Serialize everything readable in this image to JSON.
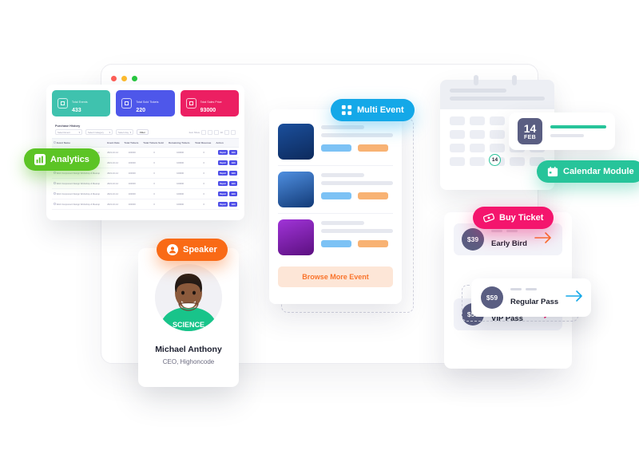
{
  "browser": {
    "name": "browser-window",
    "dots": [
      "#ff5f57",
      "#febc2e",
      "#28c840"
    ]
  },
  "dashboard": {
    "stats": [
      {
        "label": "Total Events",
        "value": "433",
        "color": "#3fc2ae",
        "icon": "list-icon"
      },
      {
        "label": "Total Sold Tickets",
        "value": "220",
        "color": "#4e57ea",
        "icon": "grid-icon"
      },
      {
        "label": "Total Sales Price",
        "value": "93000",
        "color": "#ec1f62",
        "icon": "chart-icon"
      }
    ],
    "panel_title": "Purchase History",
    "filters": {
      "select_event": "Select Event",
      "select_category": "Select Category",
      "select_day": "Select day",
      "filter_button": "Filter",
      "pager_label": "Item Show",
      "pager_value": "10"
    },
    "table": {
      "columns": [
        "Event Name",
        "Event Date",
        "Total Tickets",
        "Total Tickets Sold",
        "Remaining Tickets",
        "Total Revenue",
        "Action"
      ],
      "rows": [
        {
          "name": "Web Component Design Workshop & Meetup",
          "date": "2021-10-12",
          "total": "100000",
          "sold": "0",
          "remaining": "100000",
          "revenue": "0"
        },
        {
          "name": "Web Component Design Workshop & Meetup",
          "date": "2021-10-12",
          "total": "100000",
          "sold": "0",
          "remaining": "100000",
          "revenue": "0"
        },
        {
          "name": "Web Component Design Workshop & Meetup",
          "date": "2021-10-12",
          "total": "100000",
          "sold": "0",
          "remaining": "100000",
          "revenue": "0"
        },
        {
          "name": "Web Component Design Workshop & Meetup",
          "date": "2021-10-12",
          "total": "100000",
          "sold": "0",
          "remaining": "100000",
          "revenue": "0"
        },
        {
          "name": "Web Component Design Workshop & Meetup",
          "date": "2021-10-12",
          "total": "100000",
          "sold": "0",
          "remaining": "100000",
          "revenue": "0"
        },
        {
          "name": "Web Component Design Workshop & Meetup",
          "date": "2021-10-12",
          "total": "100000",
          "sold": "0",
          "remaining": "100000",
          "revenue": "0"
        }
      ],
      "action_report": "Report",
      "action_edit": "Edit"
    }
  },
  "badges": {
    "analytics": {
      "label": "Analytics",
      "color": "#5cc425",
      "icon": "analytics-chart-icon"
    },
    "multi_event": {
      "label": "Multi Event",
      "color": "#14a8e8",
      "icon": "grid-dots-icon"
    },
    "speaker": {
      "label": "Speaker",
      "color": "#f96a16",
      "icon": "user-circle-icon"
    },
    "calendar_module": {
      "label": "Calendar Module",
      "color": "#27c49a",
      "icon": "calendar-icon"
    },
    "buy_ticket": {
      "label": "Buy Ticket",
      "color": "#f4156d",
      "icon": "ticket-icon"
    }
  },
  "speaker": {
    "name": "Michael Anthony",
    "role": "CEO, Highoncode",
    "avatar_alt": "speaker-portrait"
  },
  "multi_event": {
    "events": [
      {
        "thumb_alt": "concert-crowd-blue",
        "thumb_from": "#1b4f9c",
        "thumb_to": "#0d2a5c"
      },
      {
        "thumb_alt": "stage-lights-blue",
        "thumb_from": "#4f8fe0",
        "thumb_to": "#123a77"
      },
      {
        "thumb_alt": "concert-purple",
        "thumb_from": "#a034d8",
        "thumb_to": "#5c1080"
      }
    ],
    "browse_button": "Browse More Event"
  },
  "calendar": {
    "today": "14",
    "event": {
      "day": "14",
      "month": "FEB"
    }
  },
  "tickets": [
    {
      "price": "$39",
      "name": "Early Bird",
      "arrow_color": "#f9742c"
    },
    {
      "price": "$59",
      "name": "Regular Pass",
      "arrow_color": "#14a8e8"
    },
    {
      "price": "$59",
      "name": "VIP Pass",
      "arrow_color": "#f4156d"
    }
  ]
}
